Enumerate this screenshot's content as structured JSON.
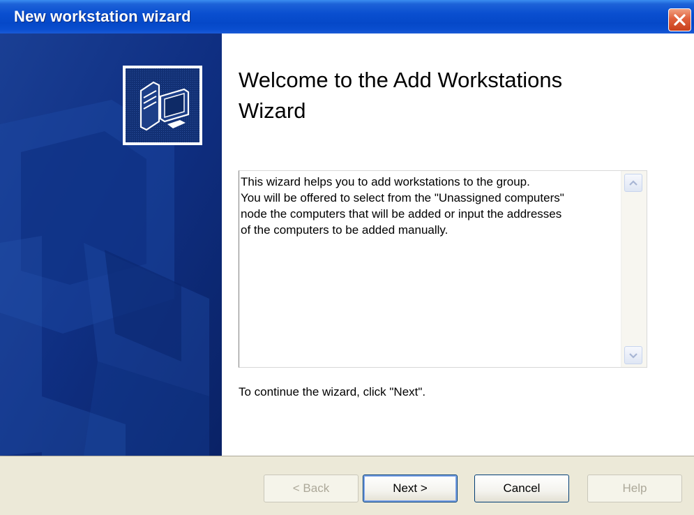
{
  "window": {
    "title": "New workstation wizard"
  },
  "heading": "Welcome to the Add Workstations Wizard",
  "description": "This wizard helps you to add workstations to the group.\nYou will be offered to select from the \"Unassigned computers\"\nnode the computers that will be added or input the addresses\nof the computers to be added manually.",
  "continue_text": "To continue the wizard, click \"Next\".",
  "buttons": {
    "back": "< Back",
    "next": "Next >",
    "cancel": "Cancel",
    "help": "Help"
  },
  "icons": {
    "close": "close-icon",
    "wizard": "computer-workstation-icon",
    "scroll_up": "scroll-up-icon",
    "scroll_down": "scroll-down-icon"
  },
  "colors": {
    "titlebar": "#0a4fd0",
    "side_panel": "#0d2a78",
    "dialog_bg": "#ece9d8",
    "close_button": "#e0603c"
  }
}
